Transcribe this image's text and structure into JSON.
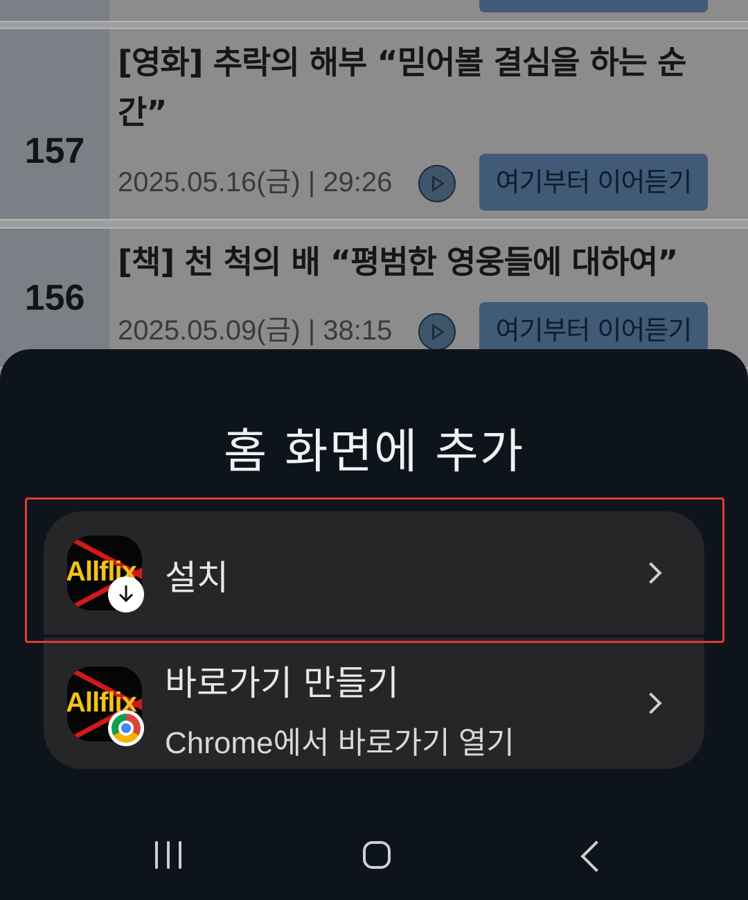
{
  "episodes": [
    {
      "number": "157",
      "title": "[영화] 추락의 해부 “믿어볼 결심을 하는 순간”",
      "meta": "2025.05.16(금) | 29:26",
      "resume_label": "여기부터 이어듣기"
    },
    {
      "number": "156",
      "title": "[책] 천 척의 배 “평범한 영웅들에 대하여”",
      "meta": "2025.05.09(금) | 38:15",
      "resume_label": "여기부터 이어듣기"
    }
  ],
  "sheet": {
    "title": "홈 화면에 추가",
    "install": {
      "label": "설치",
      "icon": "allflix-app-icon",
      "badge_icon": "download-arrow-icon"
    },
    "shortcut": {
      "label": "바로가기 만들기",
      "sublabel": "Chrome에서 바로가기 열기",
      "icon": "allflix-app-icon",
      "badge_icon": "chrome-icon"
    },
    "app_logo_text": "Allflix",
    "highlight_color": "#e53935"
  },
  "navbar": {
    "recent_icon": "recent-apps-icon",
    "home_icon": "home-icon",
    "back_icon": "back-icon"
  }
}
